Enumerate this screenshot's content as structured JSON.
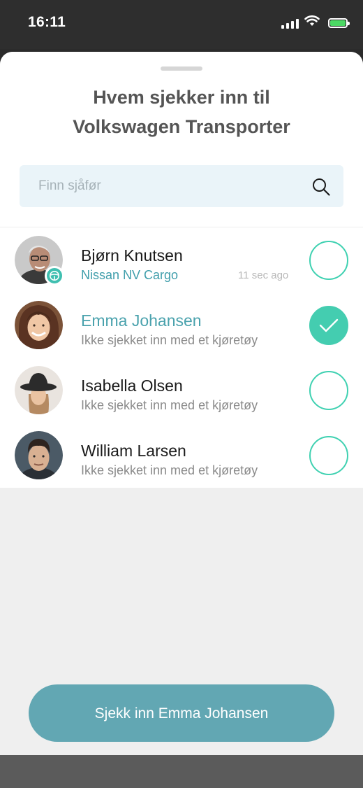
{
  "status_bar": {
    "time": "16:11",
    "battery_level": 1.0,
    "icons": [
      "cellular-signal-icon",
      "wifi-icon",
      "battery-icon"
    ]
  },
  "sheet": {
    "title_line1": "Hvem sjekker inn til",
    "title_line2": "Volkswagen Transporter"
  },
  "search": {
    "placeholder": "Finn sjåfør",
    "value": "",
    "icon": "search-icon"
  },
  "drivers": [
    {
      "name": "Bjørn Knutsen",
      "subtitle": "Nissan NV Cargo",
      "time_ago": "11 sec ago",
      "checked": false,
      "has_vehicle": true,
      "badge_icon": "steering-wheel-icon"
    },
    {
      "name": "Emma Johansen",
      "subtitle": "Ikke sjekket inn med et kjøretøy",
      "time_ago": "",
      "checked": true,
      "has_vehicle": false
    },
    {
      "name": "Isabella Olsen",
      "subtitle": "Ikke sjekket inn med et kjøretøy",
      "time_ago": "",
      "checked": false,
      "has_vehicle": false
    },
    {
      "name": "William Larsen",
      "subtitle": "Ikke sjekket inn med et kjøretøy",
      "time_ago": "",
      "checked": false,
      "has_vehicle": false
    }
  ],
  "cta": {
    "label": "Sjekk inn Emma Johansen"
  },
  "colors": {
    "accent_teal": "#44cdb0",
    "selected_name": "#4aa2ad",
    "button": "#62a7b3",
    "search_bg": "#eaf4f9"
  }
}
